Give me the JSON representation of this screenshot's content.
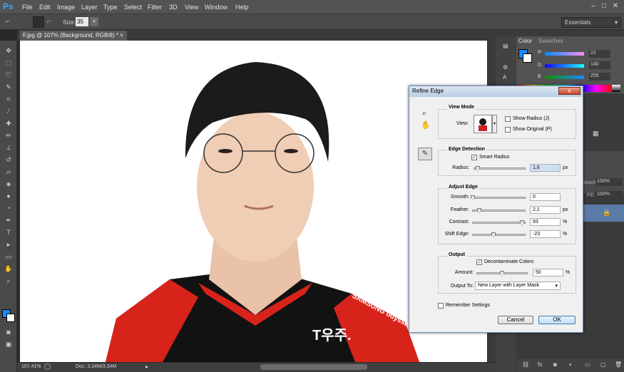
{
  "app": {
    "logo": "Ps",
    "menu": [
      "File",
      "Edit",
      "Image",
      "Layer",
      "Type",
      "Select",
      "Filter",
      "3D",
      "View",
      "Window",
      "Help"
    ]
  },
  "options": {
    "size_label": "Size:",
    "size_value": "35"
  },
  "workspace": "Essentials",
  "document": {
    "tab": "F.jpg @ 107% (Background, RGB/8) *",
    "close": "×"
  },
  "status": {
    "zoom": "107,41%",
    "doc": "Doc: 3,34M/3,34M"
  },
  "panels": {
    "color_tab": "Color",
    "swatches_tab": "Swatches",
    "r_label": "R",
    "g_label": "G",
    "b_label": "B",
    "r_value": "22",
    "g_value": "140",
    "b_value": "255",
    "opacity_label": "Opacity:",
    "opacity_value": "100%",
    "fill_label": "Fill:",
    "fill_value": "100%"
  },
  "colors": {
    "foreground": "#168cff",
    "background": "#ffffff",
    "accent": "#3fa3f5"
  },
  "dialog": {
    "title": "Refine Edge",
    "close": "x",
    "view_mode": {
      "title": "View Mode",
      "view_label": "View:",
      "show_radius": "Show Radius (J)",
      "show_original": "Show Original (P)",
      "show_radius_checked": false,
      "show_original_checked": false
    },
    "edge_detection": {
      "title": "Edge Detection",
      "smart_radius": "Smart Radius",
      "smart_radius_checked": true,
      "radius_label": "Radius:",
      "radius_value": "1,6",
      "radius_unit": "px"
    },
    "adjust_edge": {
      "title": "Adjust Edge",
      "smooth_label": "Smooth:",
      "smooth_value": "0",
      "feather_label": "Feather:",
      "feather_value": "2,1",
      "feather_unit": "px",
      "contrast_label": "Contrast:",
      "contrast_value": "93",
      "contrast_unit": "%",
      "shift_label": "Shift Edge:",
      "shift_value": "-23",
      "shift_unit": "%"
    },
    "output": {
      "title": "Output",
      "decontaminate": "Decontaminate Colors",
      "decontaminate_checked": true,
      "amount_label": "Amount:",
      "amount_value": "50",
      "amount_unit": "%",
      "output_to_label": "Output To:",
      "output_to_value": "New Layer with Layer Mask"
    },
    "remember": "Remember Settings",
    "remember_checked": false,
    "cancel": "Cancel",
    "ok": "OK"
  },
  "photo": {
    "jersey_logo": "T우주.",
    "sponsor": "SAMSUNG odyssey"
  }
}
